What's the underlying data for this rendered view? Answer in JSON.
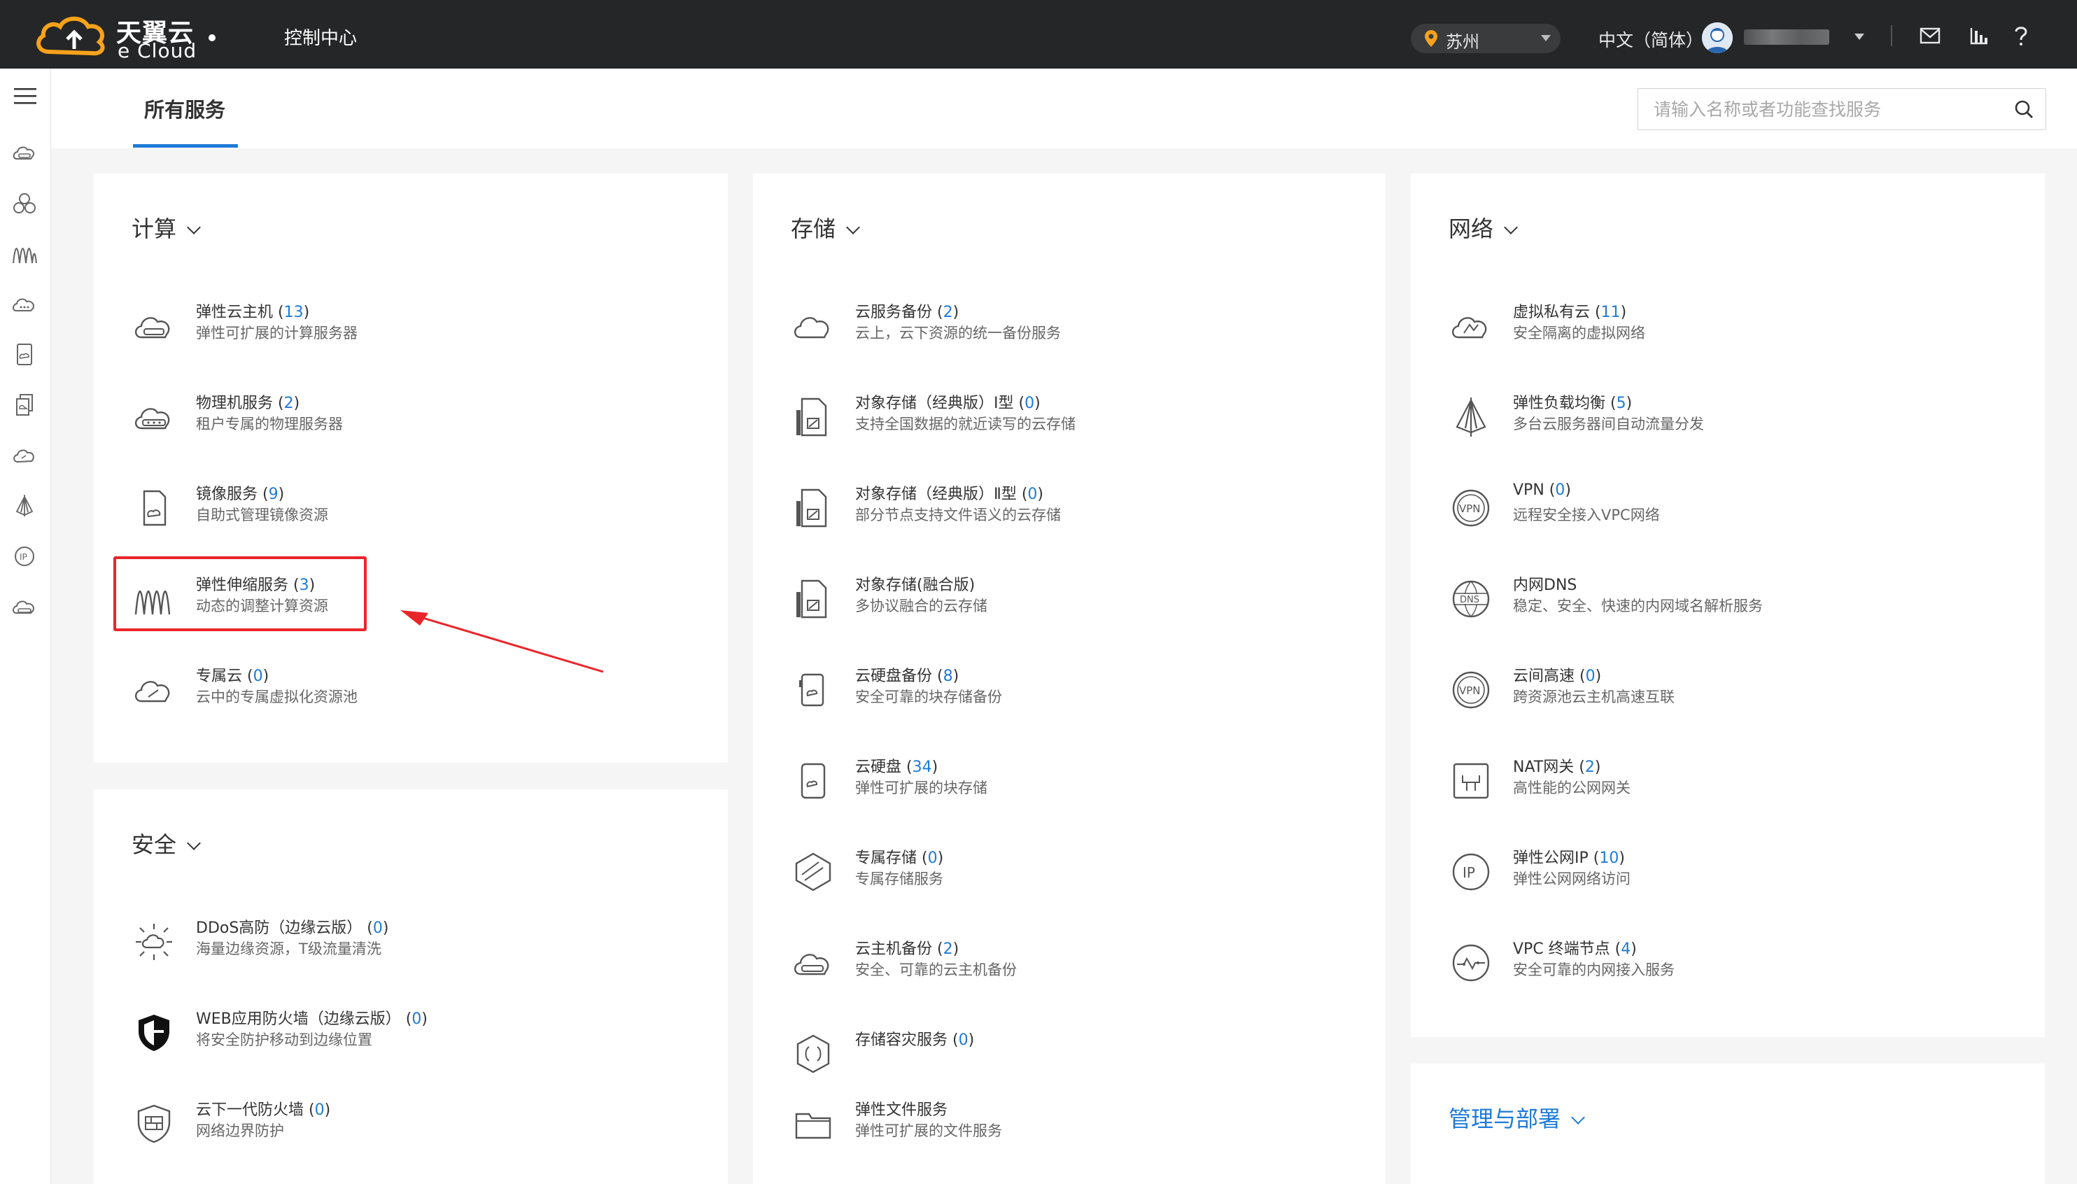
{
  "brand": {
    "logo_cn": "天翼云",
    "logo_en": "e Cloud"
  },
  "topbar": {
    "console_label": "控制中心",
    "region": "苏州",
    "language": "中文（简体）"
  },
  "header": {
    "tab_all_services": "所有服务",
    "search_placeholder": "请输入名称或者功能查找服务"
  },
  "sections": {
    "compute": {
      "title": "计算",
      "items": [
        {
          "name": "弹性云主机",
          "count": "13",
          "desc": "弹性可扩展的计算服务器"
        },
        {
          "name": "物理机服务",
          "count": "2",
          "desc": "租户专属的物理服务器"
        },
        {
          "name": "镜像服务",
          "count": "9",
          "desc": "自助式管理镜像资源"
        },
        {
          "name": "弹性伸缩服务",
          "count": "3",
          "desc": "动态的调整计算资源"
        },
        {
          "name": "专属云",
          "count": "0",
          "desc": "云中的专属虚拟化资源池"
        }
      ]
    },
    "security": {
      "title": "安全",
      "items": [
        {
          "name": "DDoS高防（边缘云版）",
          "count": "0",
          "desc": "海量边缘资源，T级流量清洗"
        },
        {
          "name": "WEB应用防火墙（边缘云版）",
          "count": "0",
          "desc": "将安全防护移动到边缘位置"
        },
        {
          "name": "云下一代防火墙",
          "count": "0",
          "desc": "网络边界防护"
        }
      ]
    },
    "storage": {
      "title": "存储",
      "items": [
        {
          "name": "云服务备份",
          "count": "2",
          "desc": "云上，云下资源的统一备份服务"
        },
        {
          "name": "对象存储（经典版）Ⅰ型",
          "count": "0",
          "desc": "支持全国数据的就近读写的云存储"
        },
        {
          "name": "对象存储（经典版）Ⅱ型",
          "count": "0",
          "desc": "部分节点支持文件语义的云存储"
        },
        {
          "name": "对象存储(融合版)",
          "count": "",
          "desc": "多协议融合的云存储"
        },
        {
          "name": "云硬盘备份",
          "count": "8",
          "desc": "安全可靠的块存储备份"
        },
        {
          "name": "云硬盘",
          "count": "34",
          "desc": "弹性可扩展的块存储"
        },
        {
          "name": "专属存储",
          "count": "0",
          "desc": "专属存储服务"
        },
        {
          "name": "云主机备份",
          "count": "2",
          "desc": "安全、可靠的云主机备份"
        },
        {
          "name": "存储容灾服务",
          "count": "0",
          "desc": ""
        },
        {
          "name": "弹性文件服务",
          "count": "",
          "desc": "弹性可扩展的文件服务"
        }
      ]
    },
    "network": {
      "title": "网络",
      "items": [
        {
          "name": "虚拟私有云",
          "count": "11",
          "desc": "安全隔离的虚拟网络"
        },
        {
          "name": "弹性负载均衡",
          "count": "5",
          "desc": "多台云服务器间自动流量分发"
        },
        {
          "name": "VPN",
          "count": "0",
          "desc": "远程安全接入VPC网络"
        },
        {
          "name": "内网DNS",
          "count": "",
          "desc": "稳定、安全、快速的内网域名解析服务"
        },
        {
          "name": "云间高速",
          "count": "0",
          "desc": "跨资源池云主机高速互联"
        },
        {
          "name": "NAT网关",
          "count": "2",
          "desc": "高性能的公网网关"
        },
        {
          "name": "弹性公网IP",
          "count": "10",
          "desc": "弹性公网网络访问"
        },
        {
          "name": "VPC 终端节点",
          "count": "4",
          "desc": "安全可靠的内网接入服务"
        }
      ]
    },
    "management": {
      "title": "管理与部署"
    }
  },
  "icons": {
    "rail": [
      "cloud-server-icon",
      "cluster-icon",
      "autoscale-icon",
      "physical-server-icon",
      "image-icon",
      "copy-icon",
      "cloud-icon",
      "load-balancer-icon",
      "ip-icon",
      "backup-icon"
    ]
  },
  "colors": {
    "accent": "#1e7bd8",
    "topbar": "#252627",
    "highlight": "#e8262a",
    "logo_orange": "#f7a21b"
  }
}
